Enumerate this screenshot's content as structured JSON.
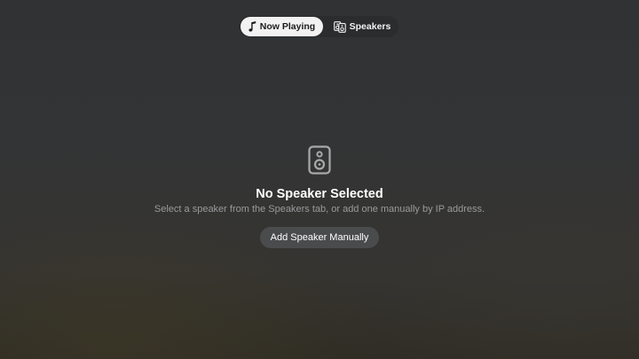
{
  "tabs": {
    "now_playing": {
      "label": "Now Playing",
      "icon": "music-note-icon",
      "selected": true
    },
    "speakers": {
      "label": "Speakers",
      "icon": "speakers-icon",
      "selected": false
    }
  },
  "empty_state": {
    "icon": "speaker-icon",
    "title": "No Speaker Selected",
    "subtitle": "Select a speaker from the Speakers tab, or add one manually by IP address.",
    "button_label": "Add Speaker Manually"
  },
  "colors": {
    "selected_tab_bg": "#f2f2f2",
    "button_bg": "#4a4b4c",
    "subtitle_text": "#9a9a9c"
  }
}
